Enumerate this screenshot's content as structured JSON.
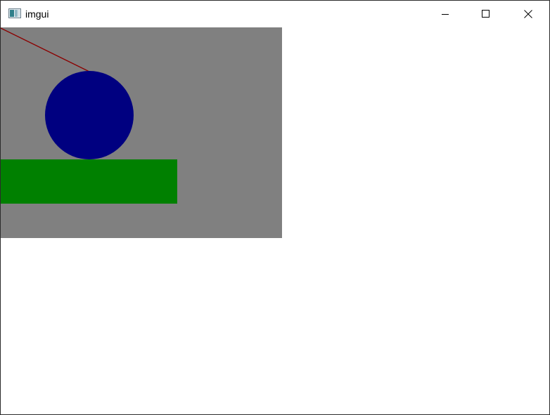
{
  "window": {
    "title": "imgui",
    "icon": "imgui-app-icon",
    "controls": {
      "minimize": "minimize-icon",
      "maximize": "maximize-icon",
      "close": "close-icon"
    }
  },
  "canvas": {
    "background_color": "#808080",
    "shapes": [
      {
        "kind": "line",
        "name": "red-line",
        "color": "#8b0000"
      },
      {
        "kind": "circle",
        "name": "blue-circle",
        "color": "#000080"
      },
      {
        "kind": "rect",
        "name": "green-rectangle",
        "color": "#008000"
      }
    ]
  }
}
